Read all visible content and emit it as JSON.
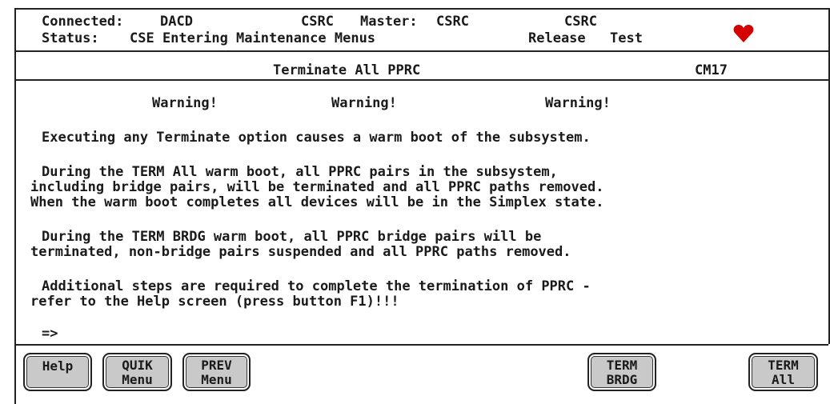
{
  "header": {
    "connected_label": "Connected:",
    "connected_value": "DACD",
    "csrc1": "CSRC",
    "master_label": "Master:",
    "master_value": "CSRC",
    "csrc2": "CSRC",
    "status_label": "Status:",
    "status_value": "CSE Entering Maintenance Menus",
    "release": "Release",
    "test": "Test",
    "heart_color": "#d40000"
  },
  "title_bar": {
    "title": "Terminate All PPRC",
    "screen_id": "CM17"
  },
  "warnings": [
    "Warning!",
    "Warning!",
    "Warning!"
  ],
  "body_lines": [
    "Executing any Terminate option causes a warm boot of the subsystem.",
    "During the TERM All warm boot, all PPRC pairs in the subsystem,",
    "including bridge pairs, will be terminated and all PPRC paths removed.",
    "When the warm boot completes all devices will be in the Simplex state.",
    "During the TERM BRDG warm boot, all PPRC bridge pairs will be",
    "terminated, non-bridge pairs suspended and all PPRC paths removed.",
    "Additional steps are required to complete the termination of PPRC -",
    "refer to the Help screen (press button F1)!!!"
  ],
  "prompt": "=>",
  "buttons": {
    "help": [
      "Help"
    ],
    "quik": [
      "QUIK",
      "Menu"
    ],
    "prev": [
      "PREV",
      "Menu"
    ],
    "term_brdg": [
      "TERM",
      "BRDG"
    ],
    "term_all": [
      "TERM",
      "All"
    ]
  }
}
